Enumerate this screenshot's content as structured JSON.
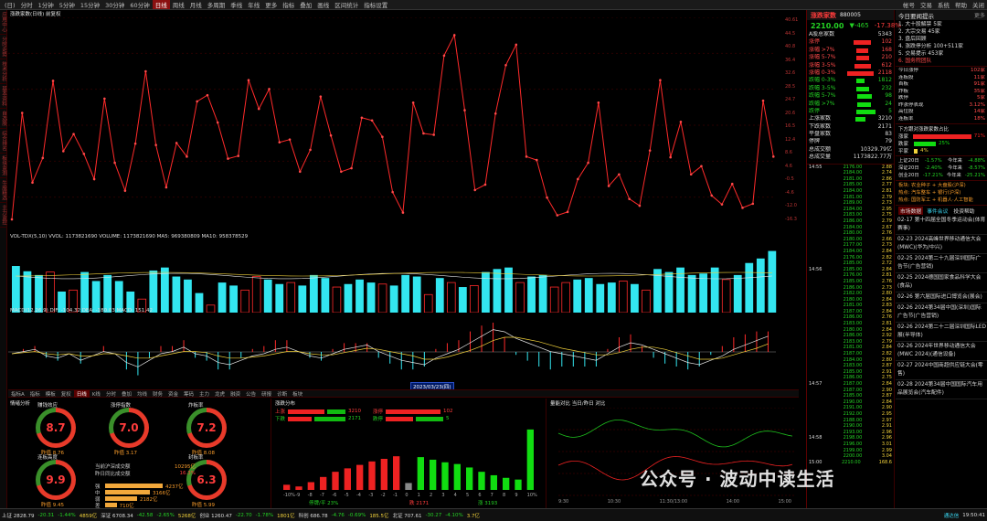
{
  "topbar": {
    "items": [
      "(日)",
      "分时",
      "1分钟",
      "5分钟",
      "15分钟",
      "30分钟",
      "60分钟",
      "日线",
      "周线",
      "月线",
      "多周期",
      "季线",
      "年线",
      "更多",
      "指标",
      "叠加",
      "画线",
      "区间统计",
      "指标设置"
    ],
    "active_index": 7,
    "right_items": [
      "帐号",
      "交易",
      "系统",
      "帮助",
      "关闭"
    ]
  },
  "left_tabs": [
    "应用中心",
    "分时走势",
    "技术分析",
    "基本资料",
    "自选股",
    "综合排名",
    "板块监测",
    "牛股精选",
    "主力监控"
  ],
  "kline": {
    "title": "涨跌家数(日线) 前复权",
    "prices": [
      12,
      168,
      66,
      102,
      215,
      112,
      137,
      108,
      71,
      189,
      95,
      54,
      123,
      229,
      121,
      59,
      124,
      104,
      185,
      194,
      154,
      101,
      105,
      216,
      174,
      203,
      125,
      129,
      82,
      114,
      192,
      135,
      82,
      87,
      161,
      157,
      133,
      52,
      22,
      183,
      138,
      136,
      252,
      282,
      172,
      55,
      63,
      167,
      238,
      268,
      104,
      99,
      44,
      18,
      23,
      71,
      95,
      183,
      61,
      78,
      42,
      32,
      113,
      216,
      103,
      155,
      78,
      90,
      47,
      34,
      64,
      29,
      35,
      186,
      104
    ],
    "axis_labels": [
      "40.61",
      "44.5",
      "40.8",
      "36.4",
      "32.6",
      "28.5",
      "24.7",
      "20.6",
      "16.5",
      "12.4",
      "8.6",
      "4.6",
      "-0.5",
      "-4.6",
      "-12.0",
      "-16.3"
    ],
    "last_label": "604.5"
  },
  "volume": {
    "title": "VOL-TDX(5,10) VVOL: 1173821690 VOLUME: 1173821690 MA5: 969380809 MA10: 958378529",
    "bars": [
      62,
      55,
      50,
      54,
      28,
      30,
      54,
      42,
      50,
      42,
      28,
      18,
      56,
      60,
      48,
      44,
      26,
      10,
      40,
      36,
      30,
      48,
      44,
      38,
      40,
      36,
      50,
      46,
      34,
      38,
      44,
      40,
      38,
      36,
      50,
      48,
      24,
      46,
      40,
      34,
      36,
      54,
      58,
      60,
      40,
      48,
      50,
      34,
      40,
      44,
      46,
      38,
      40,
      42,
      38,
      30,
      58,
      54,
      60,
      50,
      52,
      60,
      44,
      50,
      66,
      72,
      82
    ],
    "colors": [
      "c",
      "c",
      "c",
      "r",
      "c",
      "r",
      "c",
      "c",
      "c",
      "c",
      "c",
      "r",
      "c",
      "c",
      "c",
      "c",
      "c",
      "r",
      "c",
      "c",
      "r",
      "r",
      "c",
      "c",
      "r",
      "c",
      "c",
      "c",
      "r",
      "c",
      "c",
      "c",
      "r",
      "c",
      "c",
      "c",
      "r",
      "c",
      "r",
      "c",
      "r",
      "c",
      "c",
      "c",
      "r",
      "c",
      "c",
      "r",
      "r",
      "c",
      "c",
      "c",
      "c",
      "r",
      "c",
      "r",
      "c",
      "c",
      "c",
      "c",
      "c",
      "c",
      "r",
      "c",
      "c",
      "c",
      "c"
    ]
  },
  "macd": {
    "title": "MACD(12,26,9) DIF: -104.32 DEA: -180.03 MACD: 151.42",
    "dif": [
      30,
      32,
      34,
      28,
      26,
      30,
      24,
      28,
      32,
      30,
      22,
      18,
      24,
      30,
      32,
      36,
      30,
      28,
      22,
      20,
      24,
      28,
      30,
      34,
      36,
      32,
      28,
      26,
      30,
      34,
      36,
      38,
      32,
      28,
      24,
      22,
      20,
      26,
      30,
      34,
      40,
      46,
      52,
      50,
      44,
      40,
      36,
      32,
      30,
      28,
      26,
      24,
      30,
      36,
      40,
      38,
      34,
      30,
      26,
      22,
      20,
      24,
      28,
      34,
      38,
      42,
      46
    ],
    "dea": [
      30,
      31,
      32,
      30,
      29,
      30,
      28,
      28,
      30,
      30,
      28,
      26,
      26,
      28,
      30,
      32,
      32,
      31,
      28,
      26,
      26,
      27,
      28,
      30,
      32,
      32,
      30,
      29,
      29,
      31,
      33,
      35,
      34,
      32,
      30,
      28,
      25,
      25,
      27,
      30,
      33,
      37,
      42,
      45,
      45,
      43,
      41,
      38,
      35,
      33,
      31,
      29,
      29,
      31,
      34,
      36,
      36,
      34,
      31,
      28,
      25,
      25,
      26,
      29,
      32,
      35,
      39
    ]
  },
  "tabs": {
    "items": [
      "指标A",
      "指标",
      "模板",
      "复权",
      "日线",
      "K线",
      "分时",
      "叠加",
      "均线",
      "财务",
      "资金",
      "筹码",
      "主力",
      "龙虎",
      "融资",
      "公告",
      "研报",
      "诊断",
      "板块"
    ],
    "active_index": 4
  },
  "kline_date_range": "2023/03/23(四)",
  "sentiment": {
    "title": "情绪分析",
    "gauges": [
      {
        "name": "赚钱效应",
        "value": "8.7",
        "sub": "昨值 8.76"
      },
      {
        "name": "涨停指数",
        "value": "7.0",
        "sub": "昨值 3.17"
      },
      {
        "name": "炸板率",
        "value": "7.2",
        "sub": "昨值 8.08"
      },
      {
        "name": "连板高度",
        "value": "9.9",
        "sub": "昨值 9.45"
      },
      {
        "name": "封板率",
        "value": "6.3",
        "sub": "昨值 5.99"
      }
    ],
    "stats": [
      {
        "label": "当前沪深成交额",
        "value": "10295亿"
      },
      {
        "label": "昨日同比成交额",
        "value": "16.3%"
      }
    ],
    "bars": [
      {
        "label": "强",
        "value": "4237亿",
        "pct": 90
      },
      {
        "label": "中",
        "value": "3166亿",
        "pct": 70
      },
      {
        "label": "弱",
        "value": "2182亿",
        "pct": 50
      },
      {
        "label": "差",
        "value": "710亿",
        "pct": 18
      }
    ]
  },
  "dist": {
    "title": "涨跌分布",
    "up_label": "上涨",
    "down_label": "下跌",
    "limit_up": "涨停",
    "limit_down": "跌停",
    "up_count": "3210",
    "down_count": "2171",
    "limit_up_count": "102",
    "limit_down_count": "5",
    "labels": [
      "-10%",
      "-9",
      "-8",
      "-7",
      "-6",
      "-5",
      "-4",
      "-3",
      "-2",
      "-1",
      "0",
      "1",
      "2",
      "3",
      "4",
      "5",
      "6",
      "7",
      "8",
      "9",
      "10%"
    ],
    "values": [
      6,
      4,
      9,
      15,
      21,
      25,
      29,
      33,
      36,
      39,
      8,
      38,
      35,
      32,
      30,
      26,
      21,
      17,
      14,
      12,
      70
    ],
    "footer_left": "跌 2171",
    "footer_right": "涨 3193",
    "footer_mid": "停牌/平 23%"
  },
  "intraday": {
    "title": "量能对比 当日/昨日 对比",
    "times": [
      "9:30",
      "10:30",
      "11:30/13:00",
      "14:00",
      "15:00"
    ]
  },
  "right": {
    "name": "涨跌家数",
    "code": "880005",
    "price": "2210.00",
    "change": "▼-465",
    "pct": "-17.38%",
    "rows": [
      {
        "k": "A股总家数",
        "v": "5343"
      },
      {
        "k": "涨停",
        "v": "102"
      },
      {
        "k": "涨幅 >7%",
        "v": "168"
      },
      {
        "k": "涨幅 5-7%",
        "v": "210"
      },
      {
        "k": "涨幅 3-5%",
        "v": "612"
      },
      {
        "k": "涨幅 0-3%",
        "v": "2118"
      },
      {
        "k": "跌幅 0-3%",
        "v": "1812"
      },
      {
        "k": "跌幅 3-5%",
        "v": "232"
      },
      {
        "k": "跌幅 5-7%",
        "v": "98"
      },
      {
        "k": "跌幅 >7%",
        "v": "24"
      },
      {
        "k": "跌停",
        "v": "5"
      },
      {
        "k": "上涨家数",
        "v": "3210"
      },
      {
        "k": "下跌家数",
        "v": "2171"
      },
      {
        "k": "平盘家数",
        "v": "83"
      },
      {
        "k": "停牌",
        "v": "79"
      },
      {
        "k": "总成交额",
        "v": "10329.79亿"
      },
      {
        "k": "总成交量",
        "v": "1173822.77万"
      }
    ],
    "bar_widths": [
      60,
      40,
      44,
      55,
      90,
      28,
      44,
      50,
      46,
      68,
      34
    ],
    "bar_colors": [
      "r",
      "r",
      "r",
      "r",
      "r",
      "g",
      "g",
      "g",
      "g",
      "g",
      "g"
    ],
    "ticks": [
      {
        "t": "14:55",
        "p": "2176.00",
        "v": "2.88"
      },
      {
        "t": "",
        "p": "2184.00",
        "v": "2.74"
      },
      {
        "t": "",
        "p": "2181.00",
        "v": "2.86"
      },
      {
        "t": "",
        "p": "2185.00",
        "v": "2.77"
      },
      {
        "t": "",
        "p": "2184.00",
        "v": "2.81"
      },
      {
        "t": "",
        "p": "2181.00",
        "v": "2.79"
      },
      {
        "t": "",
        "p": "2189.00",
        "v": "2.73"
      },
      {
        "t": "",
        "p": "2184.00",
        "v": "2.95"
      },
      {
        "t": "",
        "p": "2183.00",
        "v": "2.75"
      },
      {
        "t": "",
        "p": "2186.00",
        "v": "2.79"
      },
      {
        "t": "",
        "p": "2184.00",
        "v": "2.67"
      },
      {
        "t": "",
        "p": "2180.00",
        "v": "2.76"
      },
      {
        "t": "",
        "p": "2180.00",
        "v": "2.66"
      },
      {
        "t": "",
        "p": "2177.00",
        "v": "2.73"
      },
      {
        "t": "",
        "p": "2184.00",
        "v": "2.84"
      },
      {
        "t": "",
        "p": "2176.00",
        "v": "2.82"
      },
      {
        "t": "",
        "p": "2185.00",
        "v": "2.72"
      },
      {
        "t": "14:56",
        "p": "2185.00",
        "v": "2.84"
      },
      {
        "t": "",
        "p": "2176.00",
        "v": "2.81"
      },
      {
        "t": "",
        "p": "2185.00",
        "v": "2.76"
      },
      {
        "t": "",
        "p": "2186.00",
        "v": "2.73"
      },
      {
        "t": "",
        "p": "2182.00",
        "v": "2.80"
      },
      {
        "t": "",
        "p": "2180.00",
        "v": "2.84"
      },
      {
        "t": "",
        "p": "2181.00",
        "v": "2.83"
      },
      {
        "t": "",
        "p": "2187.00",
        "v": "2.84"
      },
      {
        "t": "",
        "p": "2186.00",
        "v": "2.76"
      },
      {
        "t": "",
        "p": "2183.00",
        "v": "2.81"
      },
      {
        "t": "",
        "p": "2180.00",
        "v": "2.84"
      },
      {
        "t": "",
        "p": "2186.00",
        "v": "2.92"
      },
      {
        "t": "",
        "p": "2183.00",
        "v": "2.79"
      },
      {
        "t": "",
        "p": "2181.00",
        "v": "2.84"
      },
      {
        "t": "",
        "p": "2187.00",
        "v": "2.82"
      },
      {
        "t": "",
        "p": "2184.00",
        "v": "2.80"
      },
      {
        "t": "",
        "p": "2183.00",
        "v": "2.87"
      },
      {
        "t": "",
        "p": "2185.00",
        "v": "2.91"
      },
      {
        "t": "",
        "p": "2186.00",
        "v": "2.75"
      },
      {
        "t": "14:57",
        "p": "2187.00",
        "v": "2.84"
      },
      {
        "t": "",
        "p": "2187.00",
        "v": "2.90"
      },
      {
        "t": "",
        "p": "2185.00",
        "v": "2.87"
      },
      {
        "t": "",
        "p": "2190.00",
        "v": "2.84"
      },
      {
        "t": "",
        "p": "2191.00",
        "v": "2.90"
      },
      {
        "t": "",
        "p": "2192.00",
        "v": "2.95"
      },
      {
        "t": "",
        "p": "2188.00",
        "v": "2.97"
      },
      {
        "t": "",
        "p": "2190.00",
        "v": "2.91"
      },
      {
        "t": "",
        "p": "2193.00",
        "v": "2.96"
      },
      {
        "t": "14:58",
        "p": "2198.00",
        "v": "2.96"
      },
      {
        "t": "",
        "p": "2196.00",
        "v": "3.01"
      },
      {
        "t": "",
        "p": "2199.00",
        "v": "2.99"
      },
      {
        "t": "",
        "p": "2200.00",
        "v": "3.04"
      },
      {
        "t": "15:00",
        "p": "2210.00",
        "v": "168.6"
      }
    ]
  },
  "news": {
    "header": "今日要闻提示",
    "more": "更多",
    "tops": [
      "1. 大十股解禁 5家",
      "2. 大宗交易 45家",
      "3. 盘后回顾",
      "4. 涨跌停分析 100+511家",
      "5. 交易提示 453家",
      "6. 国务院团队"
    ],
    "mini": [
      {
        "k": "今日涨停",
        "v": "102家"
      },
      {
        "k": "连板股",
        "v": "11家"
      },
      {
        "k": "首板",
        "v": "91家"
      },
      {
        "k": "炸板",
        "v": "35家"
      },
      {
        "k": "跌停",
        "v": "5家"
      },
      {
        "k": "昨涨停表现",
        "v": "3.12%"
      },
      {
        "k": "高位股",
        "v": "14家"
      },
      {
        "k": "连板率",
        "v": "18%"
      }
    ],
    "bar_title": "下方跟对涨跌家数占比",
    "bar_rows": [
      {
        "k": "涨家",
        "pct": "71%",
        "w": 68,
        "c": "r"
      },
      {
        "k": "跌家",
        "pct": "25%",
        "w": 24,
        "c": "g"
      },
      {
        "k": "平家",
        "pct": "4%",
        "w": 4,
        "c": "y"
      }
    ],
    "perf": [
      {
        "k": "上证20日",
        "a": "-1.57%",
        "b": "今年来",
        "c": "-4.88%"
      },
      {
        "k": "深证20日",
        "a": "-2.40%",
        "b": "今年来",
        "c": "-8.57%"
      },
      {
        "k": "创业20日",
        "a": "-17.21%",
        "b": "今年来",
        "c": "-25.21%"
      }
    ],
    "hot": [
      "板块: 农业种子 + 大盘股(沪深)",
      "热点: 汽车整车 + 银行(沪深)",
      "热点: 国防军工 + 机器人·人工智能"
    ],
    "tabs": [
      "市场数据",
      "事件会议",
      "投资帮助"
    ],
    "items": [
      "02-17 第十四届全国冬季运动会(体育赛事)",
      "02-23 2024高峰世界移动通信大会 (MWC)(华为/中兴)",
      "02-25 2024第二十九届深圳国际广告节(广告营销)",
      "02-25 2024德国国家食品科学大会(食品)",
      "02-26 第六届国际进口博览会(展会)",
      "02-26 2024第34届中国(深圳)国际广告节(广告营销)",
      "02-26 2024第二十二届深圳国际LED展(半导体)",
      "02-26 2024年世界移动通信大会(MWC 2024)(通信设备)",
      "02-27 2024中国商超供应链大会(零售)",
      "02-28 2024第34届中国国际汽车用品展览会(汽车配件)"
    ]
  },
  "bottom": {
    "items": [
      "上证 2828.79",
      "-20.31",
      "-1.44%",
      "4859亿",
      "深证 6708.34",
      "-42.58",
      "-2.65%",
      "5268亿",
      "创业 1260.47",
      "-22.70",
      "-1.78%",
      "1801亿",
      "科创 686.78",
      "-4.76",
      "-0.69%",
      "185.5亿",
      "北证 707.61",
      "-30.27",
      "-4.10%",
      "3.7亿"
    ],
    "right": "19:50:41",
    "status": "通达信"
  },
  "watermark": "公众号 · 波动中读生活"
}
